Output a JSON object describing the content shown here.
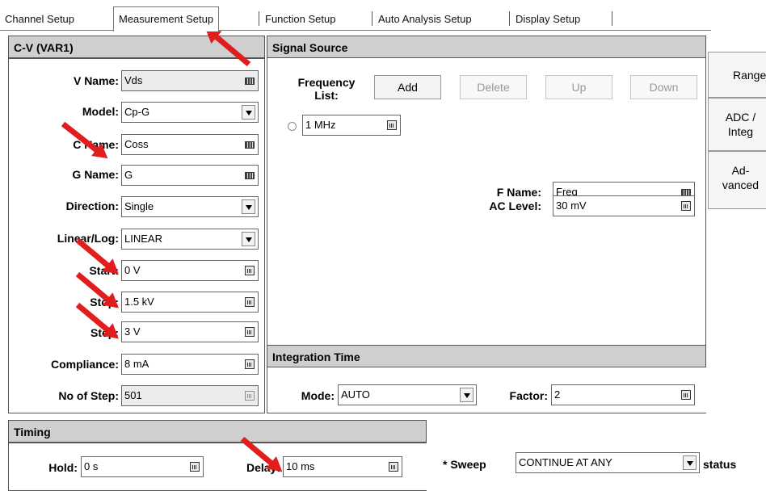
{
  "tabs": [
    {
      "label": "Channel Setup"
    },
    {
      "label": "Measurement Setup"
    },
    {
      "label": "Function Setup"
    },
    {
      "label": "Auto Analysis Setup"
    },
    {
      "label": "Display Setup"
    }
  ],
  "cv": {
    "header": "C-V (VAR1)",
    "vname": {
      "label": "V Name:",
      "value": "Vds"
    },
    "model": {
      "label": "Model:",
      "value": "Cp-G"
    },
    "cname": {
      "label": "C Name:",
      "value": "Coss"
    },
    "gname": {
      "label": "G Name:",
      "value": "G"
    },
    "direction": {
      "label": "Direction:",
      "value": "Single"
    },
    "linlog": {
      "label": "Linear/Log:",
      "value": "LINEAR"
    },
    "start": {
      "label": "Start:",
      "value": "0 V"
    },
    "stop": {
      "label": "Stop:",
      "value": "1.5 kV"
    },
    "step": {
      "label": "Step:",
      "value": "3 V"
    },
    "compliance": {
      "label": "Compliance:",
      "value": "8 mA"
    },
    "nostep": {
      "label": "No of Step:",
      "value": "501"
    }
  },
  "signal": {
    "header": "Signal Source",
    "freq_list_label_line1": "Frequency",
    "freq_list_label_line2": "List:",
    "add": "Add",
    "delete": "Delete",
    "up": "Up",
    "down": "Down",
    "freq_value": "1 MHz",
    "fname": {
      "label": "F Name:",
      "value": "Freq"
    },
    "aclevel": {
      "label": "AC Level:",
      "value": "30 mV"
    }
  },
  "side": {
    "range": "Range",
    "adc_line1": "ADC /",
    "adc_line2": "Integ",
    "adv_line1": "Ad-",
    "adv_line2": "vanced"
  },
  "integration": {
    "header": "Integration Time",
    "mode": {
      "label": "Mode:",
      "value": "AUTO"
    },
    "factor": {
      "label": "Factor:",
      "value": "2"
    }
  },
  "timing": {
    "header": "Timing",
    "hold": {
      "label": "Hold:",
      "value": "0 s"
    },
    "delay": {
      "label": "Delay:",
      "value": "10 ms"
    }
  },
  "sweep": {
    "label": "* Sweep",
    "value": "CONTINUE AT ANY",
    "suffix": "status"
  },
  "annotation_color": "#e21d1d"
}
